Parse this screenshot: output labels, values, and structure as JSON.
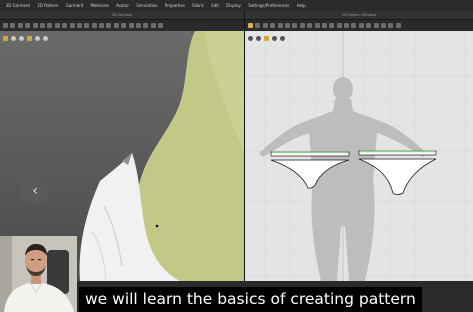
{
  "menu": [
    "3D Garment",
    "2D Pattern",
    "Garment",
    "Materials",
    "Avatar",
    "Simulation",
    "Properties",
    "Fabric",
    "Edit",
    "Display",
    "Settings/Preferences",
    "Help"
  ],
  "panels": {
    "left_title": "3D Window",
    "right_title": "2D Pattern Window"
  },
  "subtitle": "we will learn the basics of creating pattern",
  "colors": {
    "garment": "#c6c98a",
    "selected_line": "#9fd49a",
    "tool_active": "#d9b24a"
  },
  "nav_arrow": "chevron-left-icon"
}
